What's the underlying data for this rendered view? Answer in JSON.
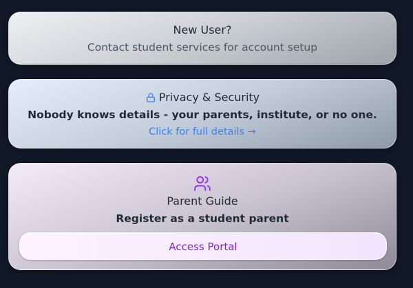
{
  "new_user": {
    "title": "New User?",
    "subtitle": "Contact student services for account setup"
  },
  "privacy": {
    "icon": "lock-icon",
    "title": "Privacy & Security",
    "statement": "Nobody knows details - your parents, institute, or no one.",
    "link": "Click for full details →",
    "link_color": "#3b82f6"
  },
  "parent": {
    "icon": "users-icon",
    "icon_color": "#9333ea",
    "title": "Parent Guide",
    "subtitle": "Register as a student parent",
    "button": "Access Portal",
    "button_color": "#7e22ce"
  }
}
